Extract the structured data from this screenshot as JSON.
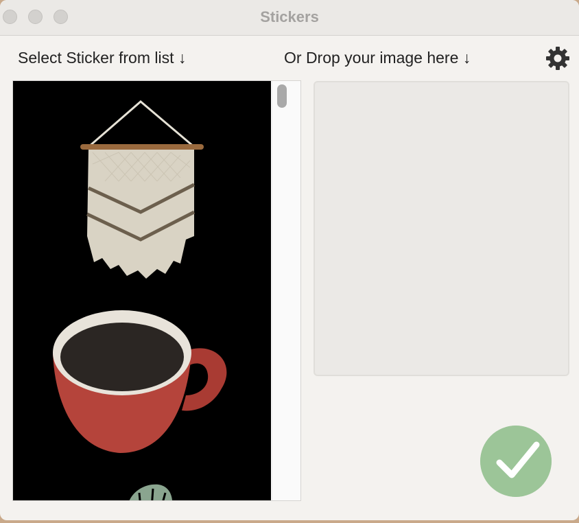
{
  "window": {
    "title": "Stickers"
  },
  "labels": {
    "select_sticker": "Select Sticker from list ↓",
    "drop_image": "Or Drop your image here ↓"
  },
  "icons": {
    "settings": "gear-icon",
    "confirm": "checkmark-icon"
  },
  "stickers": [
    {
      "name": "wall-hanging"
    },
    {
      "name": "coffee-cup"
    },
    {
      "name": "monstera-leaf"
    }
  ],
  "colors": {
    "confirm_button": "#9cc598",
    "list_background": "#000000",
    "drop_zone": "#ebe9e6"
  }
}
